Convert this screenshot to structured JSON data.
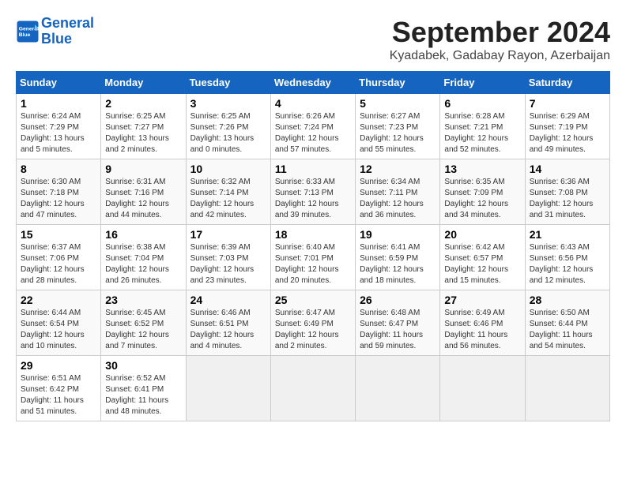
{
  "header": {
    "logo_line1": "General",
    "logo_line2": "Blue",
    "month_title": "September 2024",
    "subtitle": "Kyadabek, Gadabay Rayon, Azerbaijan"
  },
  "weekdays": [
    "Sunday",
    "Monday",
    "Tuesday",
    "Wednesday",
    "Thursday",
    "Friday",
    "Saturday"
  ],
  "weeks": [
    [
      {
        "day": 1,
        "sunrise": "6:24 AM",
        "sunset": "7:29 PM",
        "daylight": "13 hours and 5 minutes."
      },
      {
        "day": 2,
        "sunrise": "6:25 AM",
        "sunset": "7:27 PM",
        "daylight": "13 hours and 2 minutes."
      },
      {
        "day": 3,
        "sunrise": "6:25 AM",
        "sunset": "7:26 PM",
        "daylight": "13 hours and 0 minutes."
      },
      {
        "day": 4,
        "sunrise": "6:26 AM",
        "sunset": "7:24 PM",
        "daylight": "12 hours and 57 minutes."
      },
      {
        "day": 5,
        "sunrise": "6:27 AM",
        "sunset": "7:23 PM",
        "daylight": "12 hours and 55 minutes."
      },
      {
        "day": 6,
        "sunrise": "6:28 AM",
        "sunset": "7:21 PM",
        "daylight": "12 hours and 52 minutes."
      },
      {
        "day": 7,
        "sunrise": "6:29 AM",
        "sunset": "7:19 PM",
        "daylight": "12 hours and 49 minutes."
      }
    ],
    [
      {
        "day": 8,
        "sunrise": "6:30 AM",
        "sunset": "7:18 PM",
        "daylight": "12 hours and 47 minutes."
      },
      {
        "day": 9,
        "sunrise": "6:31 AM",
        "sunset": "7:16 PM",
        "daylight": "12 hours and 44 minutes."
      },
      {
        "day": 10,
        "sunrise": "6:32 AM",
        "sunset": "7:14 PM",
        "daylight": "12 hours and 42 minutes."
      },
      {
        "day": 11,
        "sunrise": "6:33 AM",
        "sunset": "7:13 PM",
        "daylight": "12 hours and 39 minutes."
      },
      {
        "day": 12,
        "sunrise": "6:34 AM",
        "sunset": "7:11 PM",
        "daylight": "12 hours and 36 minutes."
      },
      {
        "day": 13,
        "sunrise": "6:35 AM",
        "sunset": "7:09 PM",
        "daylight": "12 hours and 34 minutes."
      },
      {
        "day": 14,
        "sunrise": "6:36 AM",
        "sunset": "7:08 PM",
        "daylight": "12 hours and 31 minutes."
      }
    ],
    [
      {
        "day": 15,
        "sunrise": "6:37 AM",
        "sunset": "7:06 PM",
        "daylight": "12 hours and 28 minutes."
      },
      {
        "day": 16,
        "sunrise": "6:38 AM",
        "sunset": "7:04 PM",
        "daylight": "12 hours and 26 minutes."
      },
      {
        "day": 17,
        "sunrise": "6:39 AM",
        "sunset": "7:03 PM",
        "daylight": "12 hours and 23 minutes."
      },
      {
        "day": 18,
        "sunrise": "6:40 AM",
        "sunset": "7:01 PM",
        "daylight": "12 hours and 20 minutes."
      },
      {
        "day": 19,
        "sunrise": "6:41 AM",
        "sunset": "6:59 PM",
        "daylight": "12 hours and 18 minutes."
      },
      {
        "day": 20,
        "sunrise": "6:42 AM",
        "sunset": "6:57 PM",
        "daylight": "12 hours and 15 minutes."
      },
      {
        "day": 21,
        "sunrise": "6:43 AM",
        "sunset": "6:56 PM",
        "daylight": "12 hours and 12 minutes."
      }
    ],
    [
      {
        "day": 22,
        "sunrise": "6:44 AM",
        "sunset": "6:54 PM",
        "daylight": "12 hours and 10 minutes."
      },
      {
        "day": 23,
        "sunrise": "6:45 AM",
        "sunset": "6:52 PM",
        "daylight": "12 hours and 7 minutes."
      },
      {
        "day": 24,
        "sunrise": "6:46 AM",
        "sunset": "6:51 PM",
        "daylight": "12 hours and 4 minutes."
      },
      {
        "day": 25,
        "sunrise": "6:47 AM",
        "sunset": "6:49 PM",
        "daylight": "12 hours and 2 minutes."
      },
      {
        "day": 26,
        "sunrise": "6:48 AM",
        "sunset": "6:47 PM",
        "daylight": "11 hours and 59 minutes."
      },
      {
        "day": 27,
        "sunrise": "6:49 AM",
        "sunset": "6:46 PM",
        "daylight": "11 hours and 56 minutes."
      },
      {
        "day": 28,
        "sunrise": "6:50 AM",
        "sunset": "6:44 PM",
        "daylight": "11 hours and 54 minutes."
      }
    ],
    [
      {
        "day": 29,
        "sunrise": "6:51 AM",
        "sunset": "6:42 PM",
        "daylight": "11 hours and 51 minutes."
      },
      {
        "day": 30,
        "sunrise": "6:52 AM",
        "sunset": "6:41 PM",
        "daylight": "11 hours and 48 minutes."
      },
      null,
      null,
      null,
      null,
      null
    ]
  ]
}
